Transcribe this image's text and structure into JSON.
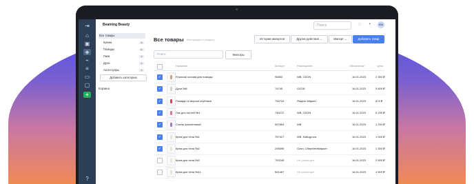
{
  "app": {
    "brand": "Beaming Beauty",
    "search_placeholder": "Поиск",
    "avatar_initials": "KN"
  },
  "tree": {
    "root": "Все товары",
    "items": [
      {
        "label": "Крема",
        "count": "3"
      },
      {
        "label": "Помады",
        "count": "2"
      },
      {
        "label": "Лаки",
        "count": "1"
      },
      {
        "label": "Духи",
        "count": "1"
      },
      {
        "label": "Аксессуары",
        "count": "1"
      }
    ],
    "add_label": "Добавить категорию",
    "cart": "Корзина"
  },
  "page": {
    "title": "Все товары",
    "hint": "Инструкции к разделу",
    "btn_import_history": "История импортов",
    "btn_other_actions": "Другие действия",
    "btn_import": "Импорт",
    "btn_add": "Добавить товар",
    "search_placeholder": "Поиск",
    "filters": "Фильтры"
  },
  "table": {
    "columns": [
      "Название",
      "Артикул",
      "Размещение",
      "Обновление",
      "Цена"
    ],
    "rows": [
      {
        "checked": true,
        "name": "Financial основа для помады",
        "sku": "95853",
        "placement": "WB, OZON",
        "muted": false,
        "date": "16.01.2023",
        "price": "2 350 ₽",
        "color": "#c9a27a"
      },
      {
        "checked": true,
        "name": "Духи №5",
        "sku": "74745",
        "placement": "OZON",
        "muted": false,
        "date": "16.01.2023",
        "price": "5 600 ₽",
        "color": "#d9d2c5"
      },
      {
        "checked": true,
        "name": "Помада со вкусом клубники",
        "sku": "745724",
        "placement": "Яндекс.Маркет",
        "muted": false,
        "date": "16.01.2023",
        "price": "874 ₽",
        "color": "#d04a5a"
      },
      {
        "checked": true,
        "name": "Лак для ногтей №1",
        "sku": "745272",
        "placement": "WB, OZON",
        "muted": false,
        "date": "16.01.2023",
        "price": "5 230 ₽",
        "color": "#e07a92"
      },
      {
        "checked": true,
        "name": "Спонж фиолетовый",
        "sku": "967854",
        "placement": "WB",
        "muted": false,
        "date": "16.01.2023",
        "price": "1 294 ₽",
        "color": "#a07ad0"
      },
      {
        "checked": true,
        "name": "Крем для тела №1",
        "sku": "757427",
        "placement": "WB, Kaltugrova",
        "muted": false,
        "date": "16.01.2023",
        "price": "1 000 ₽",
        "color": "#e9e4da"
      },
      {
        "checked": true,
        "name": "Крем для тела №2",
        "sku": "245695",
        "placement": "Ozon, СберМегаМаркет",
        "muted": false,
        "date": "16.01.2023",
        "price": "1 300 ₽",
        "color": "#e9e4da"
      },
      {
        "checked": false,
        "name": "Крем для тела №3",
        "sku": "753245",
        "placement": "Не размещен",
        "muted": true,
        "date": "16.01.2023",
        "price": "2 500 ₽",
        "color": "#e9e4da"
      },
      {
        "checked": false,
        "name": "Крем для тела №11",
        "sku": "501467",
        "placement": "Не размещен",
        "muted": true,
        "date": "16.01.2023",
        "price": "1 500 ₽",
        "color": "#e9e4da"
      }
    ]
  }
}
